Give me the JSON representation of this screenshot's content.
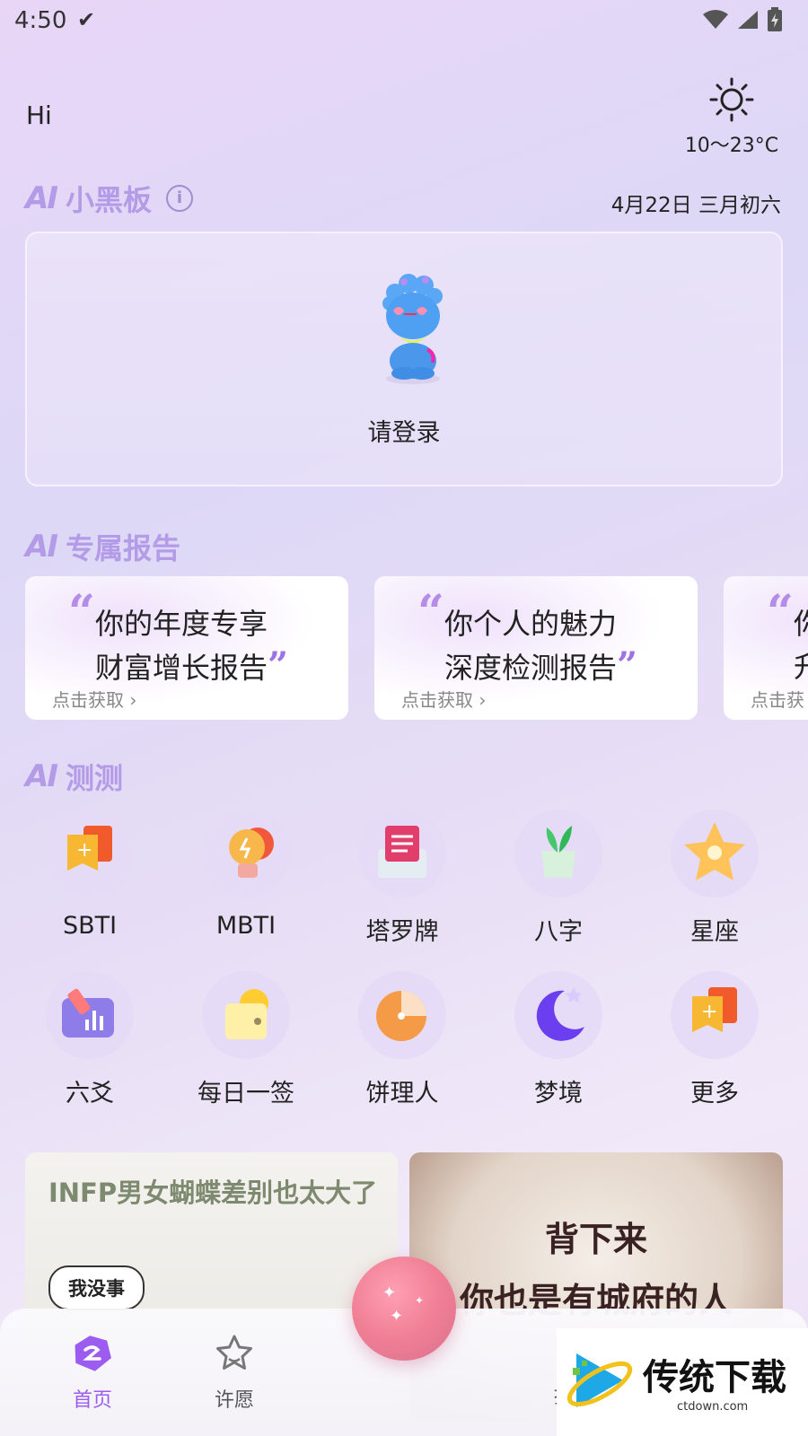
{
  "status_bar": {
    "time": "4:50"
  },
  "greeting": "Hi",
  "weather": {
    "temp": "10～23°C",
    "icon": "sun-icon"
  },
  "blackboard": {
    "logo": "AI",
    "title": "小黑板",
    "date": "4月22日 三月初六",
    "login_text": "请登录"
  },
  "reports": {
    "logo": "AI",
    "title": "专属报告",
    "cards": [
      {
        "line1": "你的年度专享",
        "line2": "财富增长报告",
        "cta": "点击获取 ›"
      },
      {
        "line1": "你个人的魅力",
        "line2": "深度检测报告",
        "cta": "点击获取 ›"
      },
      {
        "line1": "你",
        "line2": "升",
        "cta": "点击获"
      }
    ]
  },
  "tests": {
    "logo": "AI",
    "title": "测测",
    "items": [
      {
        "label": "SBTI",
        "icon": "sbti-icon"
      },
      {
        "label": "MBTI",
        "icon": "mbti-icon"
      },
      {
        "label": "塔罗牌",
        "icon": "tarot-icon"
      },
      {
        "label": "八字",
        "icon": "bazi-icon"
      },
      {
        "label": "星座",
        "icon": "zodiac-icon"
      },
      {
        "label": "六爻",
        "icon": "liuyao-icon"
      },
      {
        "label": "每日一签",
        "icon": "daily-sign-icon"
      },
      {
        "label": "饼理人",
        "icon": "pie-icon"
      },
      {
        "label": "梦境",
        "icon": "dream-icon"
      },
      {
        "label": "更多",
        "icon": "more-icon"
      }
    ]
  },
  "content_cards": {
    "card1_title": "INFP男女蝴蝶差别也太大了",
    "card1_bubble": "我没事",
    "card2_line1": "背下来",
    "card2_line2": "你也是有城府的人"
  },
  "bottom_nav": {
    "items": [
      {
        "label": "首页",
        "active": true
      },
      {
        "label": "许愿",
        "active": false
      },
      {
        "label": "扌",
        "active": false
      }
    ]
  },
  "watermark": {
    "text": "传统下载",
    "url": "ctdown.com"
  },
  "colors": {
    "accent": "#9d72e6",
    "section_title": "#b39be8",
    "fab": "#f07f94"
  }
}
